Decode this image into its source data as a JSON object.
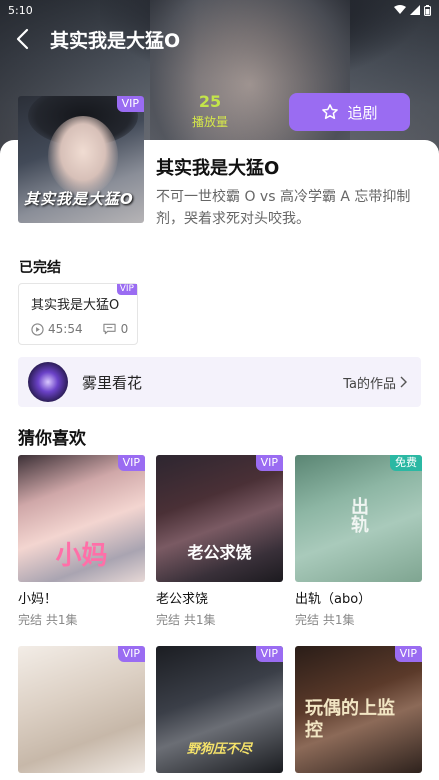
{
  "status_bar": {
    "time": "5:10"
  },
  "header": {
    "title": "其实我是大猛O"
  },
  "stats": {
    "play_count": "25",
    "play_label": "播放量"
  },
  "follow_button": {
    "label": "追剧"
  },
  "drama": {
    "cover_badge": "VIP",
    "cover_text": "其实我是大猛O",
    "title": "其实我是大猛O",
    "description": "不可一世校霸 O vs 高冷学霸 A 忘带抑制剂，哭着求死对头咬我。"
  },
  "episodes": {
    "status_label": "已完结",
    "items": [
      {
        "title": "其实我是大猛O",
        "badge": "VIP",
        "duration": "45:54",
        "comments": "0"
      }
    ]
  },
  "author": {
    "name": "雾里看花",
    "works_link": "Ta的作品"
  },
  "recommend": {
    "title": "猜你喜欢",
    "items": [
      {
        "title": "小妈！",
        "meta": "完结 共1集",
        "badge": "VIP",
        "overlay": "小妈"
      },
      {
        "title": "老公求饶",
        "meta": "完结 共1集",
        "badge": "VIP",
        "overlay": "老公求饶"
      },
      {
        "title": "出轨（abo）",
        "meta": "完结 共1集",
        "badge": "免费",
        "overlay": "出轨"
      },
      {
        "title": "",
        "meta": "",
        "badge": "VIP",
        "overlay": ""
      },
      {
        "title": "",
        "meta": "",
        "badge": "VIP",
        "overlay": "野狗压不尽"
      },
      {
        "title": "",
        "meta": "",
        "badge": "VIP",
        "overlay": "玩偶的上监控"
      }
    ]
  },
  "colors": {
    "accent": "#9a6cf2",
    "free_badge": "#2bb8a3",
    "play_count": "#c3e44a"
  }
}
